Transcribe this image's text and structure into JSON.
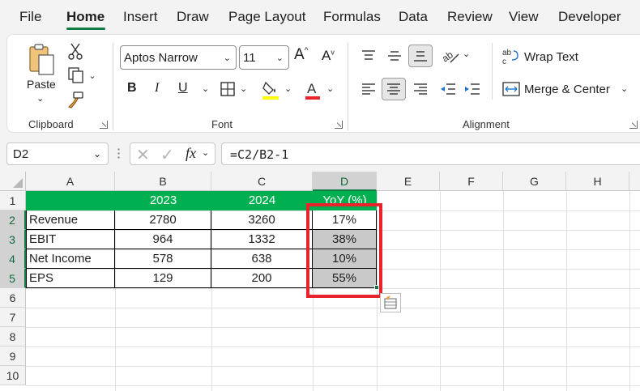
{
  "menu": {
    "tabs": [
      "File",
      "Home",
      "Insert",
      "Draw",
      "Page Layout",
      "Formulas",
      "Data",
      "Review",
      "View",
      "Developer"
    ],
    "active_tab": "Home"
  },
  "ribbon": {
    "clipboard": {
      "paste_label": "Paste",
      "group_label": "Clipboard"
    },
    "font": {
      "font_name": "Aptos Narrow",
      "font_size": "11",
      "bold": "B",
      "italic": "I",
      "underline": "U",
      "group_label": "Font",
      "fill_color": "#ffff00",
      "font_color": "#e8232b"
    },
    "alignment": {
      "wrap_text_label": "Wrap Text",
      "merge_center_label": "Merge & Center",
      "group_label": "Alignment"
    }
  },
  "formula_bar": {
    "name_box": "D2",
    "formula": "=C2/B2-1"
  },
  "sheet": {
    "columns": [
      "A",
      "B",
      "C",
      "D",
      "E",
      "F",
      "G",
      "H"
    ],
    "selected_column": "D",
    "rows": [
      "1",
      "2",
      "3",
      "4",
      "5",
      "6",
      "7",
      "8",
      "9",
      "10"
    ],
    "selected_rows": [
      "2",
      "3",
      "4",
      "5"
    ],
    "header_row": [
      "",
      "2023",
      "2024",
      "YoY (%)"
    ],
    "data_rows": [
      [
        "Revenue",
        "2780",
        "3260",
        "17%"
      ],
      [
        "EBIT",
        "964",
        "1332",
        "38%"
      ],
      [
        "Net Income",
        "578",
        "638",
        "10%"
      ],
      [
        "EPS",
        "129",
        "200",
        "55%"
      ]
    ],
    "header_fill": "#00b050",
    "highlight_color": "#e8232b"
  }
}
